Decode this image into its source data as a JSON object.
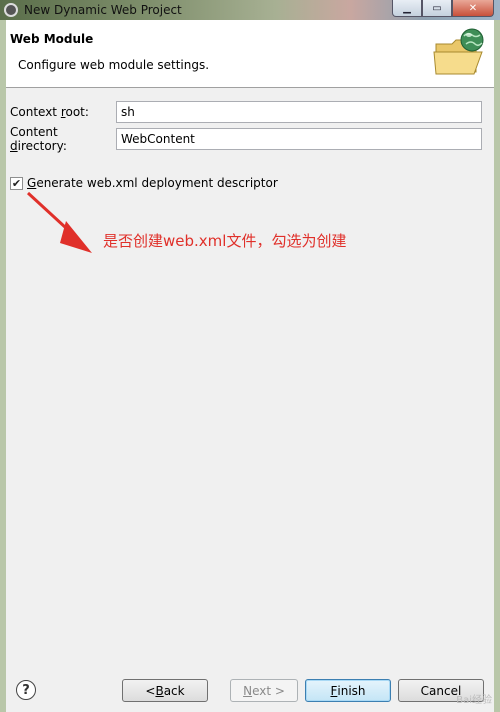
{
  "window": {
    "title": "New Dynamic Web Project",
    "minimize_glyph": "▁",
    "maximize_glyph": "▭",
    "close_glyph": "✕"
  },
  "banner": {
    "title": "Web Module",
    "description": "Configure web module settings.",
    "icon": "folder-globe-icon"
  },
  "form": {
    "context_root": {
      "label_pre": "Context ",
      "label_mnemonic": "r",
      "label_post": "oot:",
      "value": "sh"
    },
    "content_directory": {
      "label_pre": "Content ",
      "label_mnemonic": "d",
      "label_post": "irectory:",
      "value": "WebContent"
    },
    "generate_descriptor": {
      "label_mnemonic": "G",
      "label_post": "enerate web.xml deployment descriptor",
      "checked": true,
      "check_glyph": "✔"
    }
  },
  "annotation": {
    "text": "是否创建web.xml文件，勾选为创建",
    "color": "#e0302a"
  },
  "buttons": {
    "help_glyph": "?",
    "back": {
      "pre": "< ",
      "mnemonic": "B",
      "post": "ack"
    },
    "next": {
      "mnemonic": "N",
      "post": "ext >"
    },
    "finish": {
      "mnemonic": "F",
      "post": "inish"
    },
    "cancel": "Cancel"
  },
  "watermark": "Bai经验"
}
